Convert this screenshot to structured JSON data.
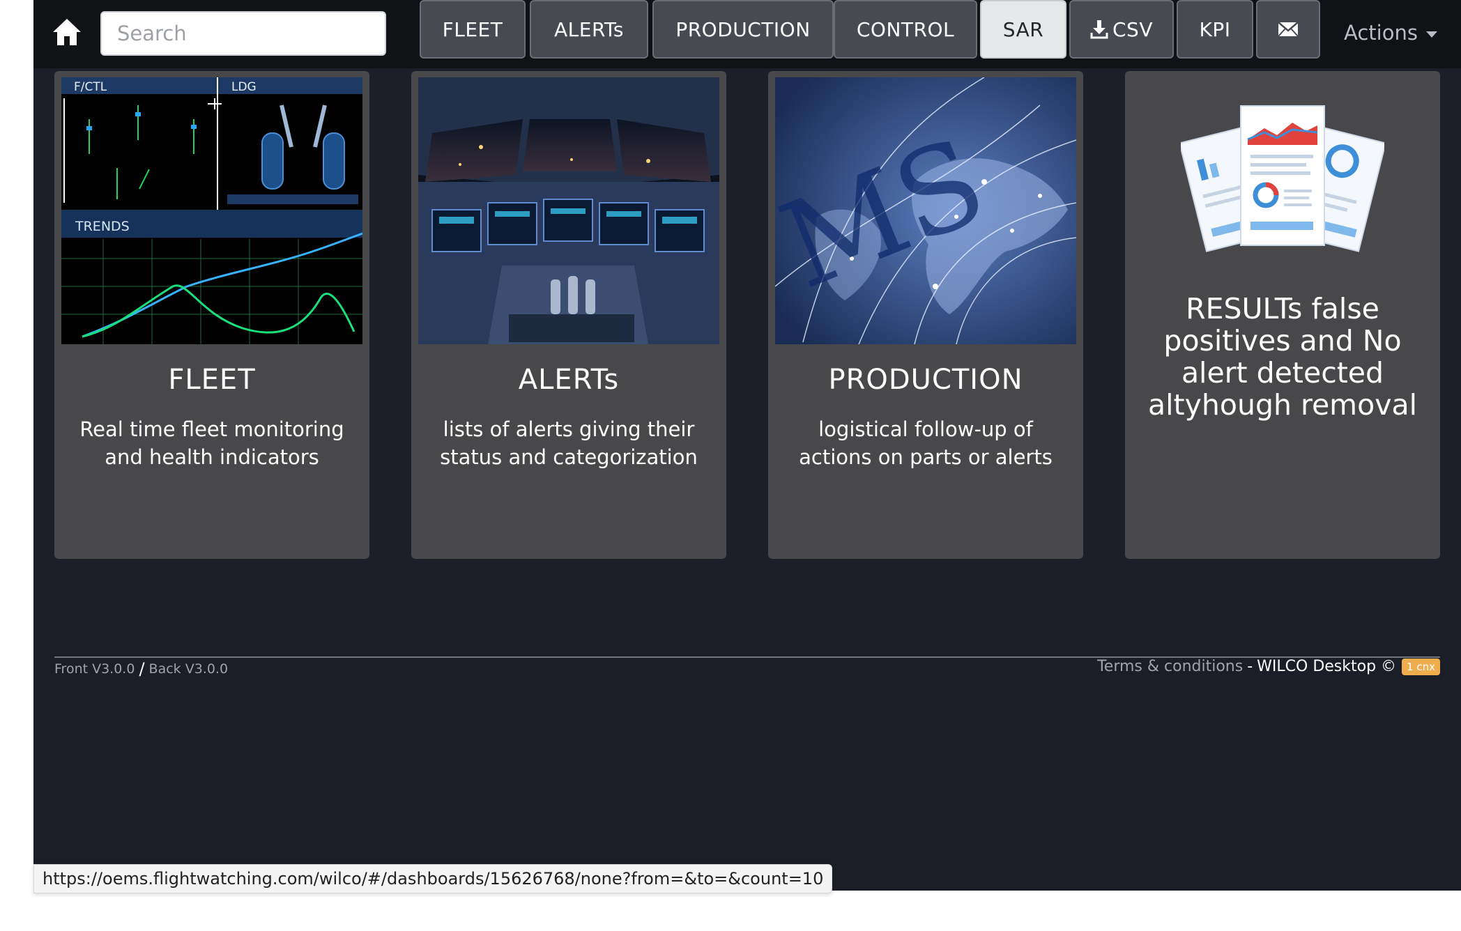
{
  "search": {
    "placeholder": "Search"
  },
  "nav": {
    "home_icon": "home-icon",
    "buttons": [
      {
        "label": "FLEET",
        "active": false
      },
      {
        "label": "ALERTs",
        "active": false
      },
      {
        "label": "PRODUCTION",
        "active": false
      },
      {
        "label": "CONTROL",
        "active": false
      },
      {
        "label": "SAR",
        "active": true
      },
      {
        "label": "CSV",
        "icon": "download-icon",
        "active": false
      },
      {
        "label": "KPI",
        "active": false
      },
      {
        "label": "",
        "icon": "envelope-icon",
        "active": false
      }
    ],
    "actions_label": "Actions"
  },
  "cards": [
    {
      "title": "FLEET",
      "description": "Real time fleet monitoring and health indicators",
      "image": {
        "panel_left": "F/CTL",
        "panel_right": "LDG",
        "trends_label": "TRENDS"
      }
    },
    {
      "title": "ALERTs",
      "description": "lists of alerts giving their status and categorization"
    },
    {
      "title": "PRODUCTION",
      "description": "logistical follow-up of actions on parts or alerts"
    },
    {
      "title": "RESULTs false positives and No alert detected altyhough removal",
      "icon": "report-documents-icon"
    }
  ],
  "footer": {
    "front_version": "Front V3.0.0",
    "separator": "/",
    "back_version": "Back V3.0.0",
    "terms_label": "Terms & conditions",
    "dash": "-",
    "brand": "WILCO Desktop ©",
    "badge": "1 cnx"
  },
  "status_url": "https://oems.flightwatching.com/wilco/#/dashboards/15626768/none?from=&to=&count=10",
  "colors": {
    "background": "#1b1e27",
    "navbar": "#101216",
    "card": "#48484a",
    "active_button": "#e7e8ea",
    "badge": "#f0ad4e"
  }
}
